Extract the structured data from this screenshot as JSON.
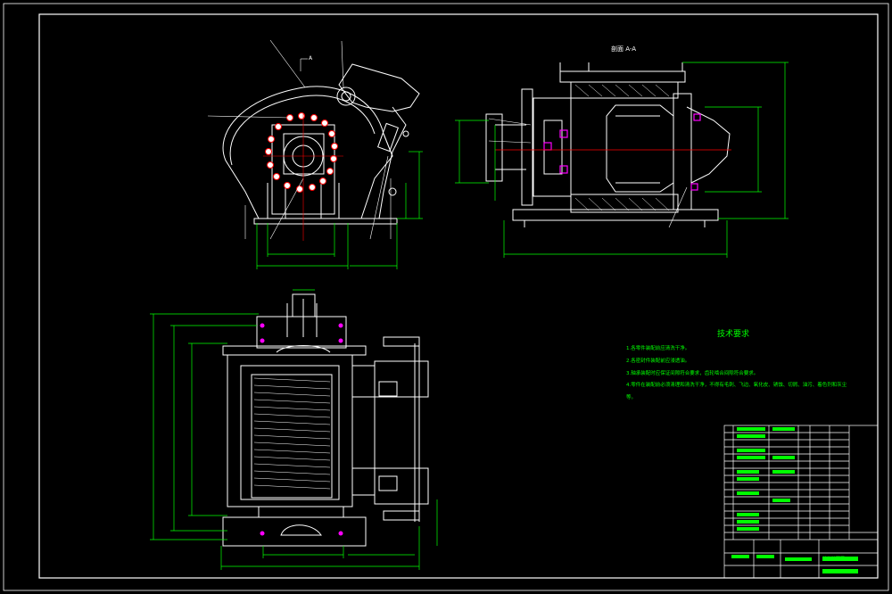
{
  "section_title": "剖面 A-A",
  "tech_req_title": "技术要求",
  "tech_req_items": [
    "1.各零件装配前应清洗干净。",
    "2.各密封件装配前应浸透油。",
    "3.轴承装配时应保证间隙符合要求，齿轮啮合间隙符合要求。",
    "4.零件在装配前必须清理和清洗干净，不得有毛刺、飞边、氧化皮、锈蚀、切屑、油污、着色剂和灰尘"
  ],
  "tech_req_tail": "等。",
  "section_marker": "A",
  "title_block_name": "绞车装配图",
  "title_block_code": "JC-00",
  "colors": {
    "background": "#000000",
    "border": "#ffffff",
    "dimension": "#00ff00",
    "centerline": "#ff0000",
    "highlight": "#ff00ff",
    "part_line": "#ffffff"
  }
}
